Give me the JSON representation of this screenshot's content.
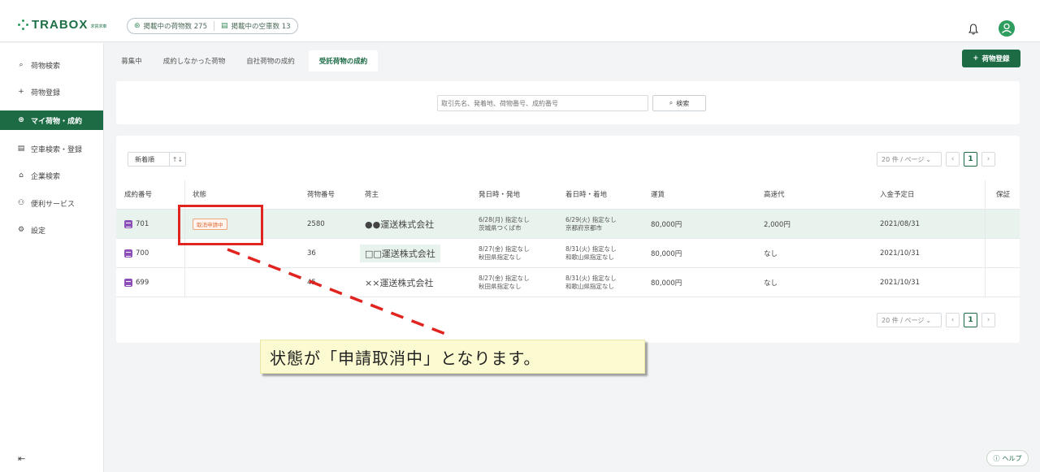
{
  "header": {
    "logo_text": "TRABOX",
    "logo_sub": "求貨求車",
    "stats": [
      {
        "icon": "cube-icon",
        "label": "掲載中の荷物数 275"
      },
      {
        "icon": "truck-icon",
        "label": "掲載中の空車数 13"
      }
    ],
    "avatar_icon": "user-icon"
  },
  "sidebar": {
    "items": [
      {
        "icon": "⌕",
        "label": "荷物検索"
      },
      {
        "icon": "+",
        "label": "荷物登録"
      },
      {
        "icon": "⊛",
        "label": "マイ荷物・成約"
      },
      {
        "icon": "▤",
        "label": "空車検索・登録"
      },
      {
        "icon": "⌂",
        "label": "企業検索"
      },
      {
        "icon": "⚇",
        "label": "便利サービス"
      },
      {
        "icon": "⚙",
        "label": "設定"
      }
    ],
    "active_index": 2,
    "collapse_icon": "⇤"
  },
  "tabs": [
    "募集中",
    "成約しなかった荷物",
    "自社荷物の成約",
    "受託荷物の成約"
  ],
  "active_tab": 3,
  "add_button": "荷物登録",
  "search": {
    "placeholder": "取引先名、発着地、荷物番号、成約番号",
    "button_label": "検索"
  },
  "sort": {
    "label": "新着順",
    "icon": "↑↓"
  },
  "pagination": {
    "per_page": "20 件 / ページ",
    "current_page": "1"
  },
  "table": {
    "columns": [
      "成約番号",
      "状態",
      "荷物番号",
      "荷主",
      "発日時・発地",
      "着日時・着地",
      "運賃",
      "高速代",
      "入金予定日",
      "保証"
    ],
    "rows": [
      {
        "id": "701",
        "status": "取消申請中",
        "cargo_no": "2580",
        "shipper": "●●運送株式会社",
        "dep_date": "6/28(月) 指定なし",
        "dep_place": "茨城県つくば市",
        "arr_date": "6/29(火) 指定なし",
        "arr_place": "京都府京都市",
        "fare": "80,000円",
        "toll": "2,000円",
        "payment_date": "2021/08/31",
        "guarantee": ""
      },
      {
        "id": "700",
        "status": "",
        "cargo_no": "36",
        "shipper": "□□運送株式会社",
        "dep_date": "8/27(金) 指定なし",
        "dep_place": "秋田県指定なし",
        "arr_date": "8/31(火) 指定なし",
        "arr_place": "和歌山県指定なし",
        "fare": "80,000円",
        "toll": "なし",
        "payment_date": "2021/10/31",
        "guarantee": ""
      },
      {
        "id": "699",
        "status": "",
        "cargo_no": "45",
        "shipper": "××運送株式会社",
        "dep_date": "8/27(金) 指定なし",
        "dep_place": "秋田県指定なし",
        "arr_date": "8/31(火) 指定なし",
        "arr_place": "和歌山県指定なし",
        "fare": "80,000円",
        "toll": "なし",
        "payment_date": "2021/10/31",
        "guarantee": ""
      }
    ]
  },
  "annotation": {
    "text": "状態が「申請取消中」となります。"
  },
  "help": {
    "label": "ヘルプ"
  }
}
